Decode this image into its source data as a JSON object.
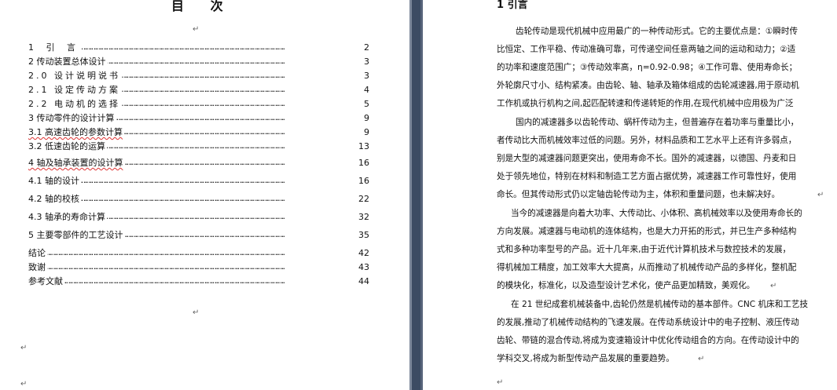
{
  "left_page": {
    "title": "目 次",
    "entries": [
      {
        "label": "1 引 言",
        "page": "2"
      },
      {
        "label": "2 传动装置总体设计",
        "page": "3"
      },
      {
        "label": "2.0 设计说明说书",
        "page": "3"
      },
      {
        "label": "2.1 设定传动方案",
        "page": "4"
      },
      {
        "label": "2.2 电动机的选择",
        "page": "5"
      },
      {
        "label": "3 传动零件的设计计算",
        "page": "9"
      },
      {
        "label": "3.1 高速齿轮的参数计算",
        "page": "9"
      },
      {
        "label": "3.2 低速齿轮的运算",
        "page": "13"
      },
      {
        "label": "4 轴及轴承装置的设计算",
        "page": "16"
      },
      {
        "label": "4.1 轴的设计",
        "page": "16"
      },
      {
        "label": "4.2 轴的校核",
        "page": "22"
      },
      {
        "label": "4.3 轴承的寿命计算",
        "page": "32"
      },
      {
        "label": "5 主要零部件的工艺设计",
        "page": "35"
      },
      {
        "label": "结论",
        "page": "42"
      },
      {
        "label": "致谢",
        "page": "43"
      },
      {
        "label": "参考文献",
        "page": "44"
      }
    ]
  },
  "right_page": {
    "heading": "1 引言",
    "lines": [
      "齿轮传动是现代机械中应用最广的一种传动形式。它的主要优点是：①瞬时传",
      "比恒定、工作平稳、传动准确可靠，可传递空间任意两轴之间的运动和动力；②适",
      "的功率和速度范围广；③传动效率高，η=0.92-0.98；④工作可靠、使用寿命长；",
      "外轮廓尺寸小、结构紧凑。由齿轮、轴、轴承及箱体组成的齿轮减速器,用于原动机",
      "工作机或执行机构之间,起匹配转速和传递转矩的作用,在现代机械中应用极为广泛",
      "国内的减速器多以齿轮传动、蜗杆传动为主，但普遍存在着功率与重量比小，",
      "者传动比大而机械效率过低的问题。另外，材料品质和工艺水平上还有许多弱点，",
      "别是大型的减速器问题更突出，使用寿命不长。国外的减速器，以德国、丹麦和日",
      "处于领先地位，特别在材料和制造工艺方面占据优势，减速器工作可靠性好，使用",
      "命长。但其传动形式仍以定轴齿轮传动为主，体积和重量问题，也未解决好。",
      "当今的减速器是向着大功率、大传动比、小体积、高机械效率以及使用寿命长的",
      "方向发展。减速器与电动机的连体结构，也是大力开拓的形式，并已生产多种结构",
      "式和多种功率型号的产品。近十几年来,由于近代计算机技术与数控技术的发展，",
      "得机械加工精度，加工效率大大提高，从而推动了机械传动产品的多样化，整机配",
      "的模块化，标准化，以及造型设计艺术化，使产品更加精致，美观化。",
      "在 21 世纪成套机械装备中,齿轮仍然是机械传动的基本部件。CNC 机床和工艺技",
      "的发展,推动了机械传动结构的飞速发展。在传动系统设计中的电子控制、液压传动",
      "齿轮、带链的混合传动,将成为变速箱设计中优化传动组合的方向。在传动设计中的",
      "学科交叉,将成为新型传动产品发展的重要趋势。"
    ]
  },
  "marks": {
    "paragraph": "↵",
    "dots": "………………………………………………………………………………………………………………………………………"
  }
}
